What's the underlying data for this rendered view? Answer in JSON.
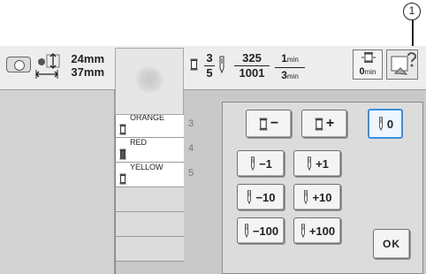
{
  "callout": {
    "number": "1"
  },
  "top_bar": {
    "embroidery_size": {
      "width": "24mm",
      "height": "37mm"
    },
    "color_progress": {
      "numerator": "3",
      "denominator": "5"
    },
    "stitch_progress": {
      "numerator": "325",
      "denominator": "1001"
    },
    "time": {
      "elapsed": "1",
      "elapsed_unit": "min",
      "remaining": "3",
      "remaining_unit": "min"
    },
    "time_until_stop": {
      "value": "0",
      "unit": "min"
    }
  },
  "thread_list": [
    {
      "name": "ORANGE",
      "number": "3"
    },
    {
      "name": "RED",
      "number": "4"
    },
    {
      "name": "YELLOW",
      "number": "5"
    }
  ],
  "stitch_dialog": {
    "buttons": [
      {
        "key": "color_back",
        "label": "−"
      },
      {
        "key": "color_forward",
        "label": "+"
      },
      {
        "key": "needle_reset",
        "label": "0"
      },
      {
        "key": "minus_1",
        "label": "−1"
      },
      {
        "key": "plus_1",
        "label": "+1"
      },
      {
        "key": "minus_10",
        "label": "−10"
      },
      {
        "key": "plus_10",
        "label": "+10"
      },
      {
        "key": "minus_100",
        "label": "−100"
      },
      {
        "key": "plus_100",
        "label": "+100"
      }
    ],
    "ok_label": "OK"
  },
  "icons": {
    "frame": "embroidery-frame-icon",
    "size": "embroidery-size-icon",
    "spool": "thread-spool-icon",
    "needle": "needle-icon",
    "help": "help-icon"
  },
  "colors": {
    "active_border": "#3b8fe0",
    "screen": "#c9c9c9"
  }
}
